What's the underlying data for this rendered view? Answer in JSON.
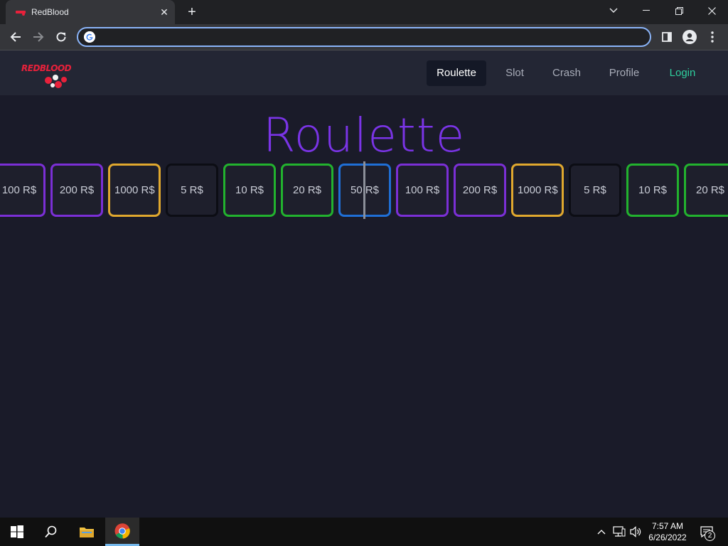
{
  "browser": {
    "tab_title": "RedBlood",
    "address_value": "",
    "address_placeholder": ""
  },
  "site": {
    "logo_text": "REDBLOOD",
    "nav": {
      "roulette": "Roulette",
      "slot": "Slot",
      "crash": "Crash",
      "profile": "Profile",
      "login": "Login"
    },
    "title": "Roulette"
  },
  "roulette_tiles": [
    {
      "label": "100 R$",
      "color": "#7b2fd6"
    },
    {
      "label": "200 R$",
      "color": "#7b2fd6"
    },
    {
      "label": "1000 R$",
      "color": "#e0a82e"
    },
    {
      "label": "5 R$",
      "color": "#0c0d14"
    },
    {
      "label": "10 R$",
      "color": "#22b22e"
    },
    {
      "label": "20 R$",
      "color": "#22b22e"
    },
    {
      "label": "50 R$",
      "color": "#1f6fd6"
    },
    {
      "label": "100 R$",
      "color": "#7b2fd6"
    },
    {
      "label": "200 R$",
      "color": "#7b2fd6"
    },
    {
      "label": "1000 R$",
      "color": "#e0a82e"
    },
    {
      "label": "5 R$",
      "color": "#0c0d14"
    },
    {
      "label": "10 R$",
      "color": "#22b22e"
    },
    {
      "label": "20 R$",
      "color": "#22b22e"
    }
  ],
  "taskbar": {
    "time": "7:57 AM",
    "date": "6/26/2022",
    "notifications": "2"
  },
  "colors": {
    "accent": "#7a34e6",
    "login": "#2fcf9e",
    "background": "#1a1b29"
  }
}
